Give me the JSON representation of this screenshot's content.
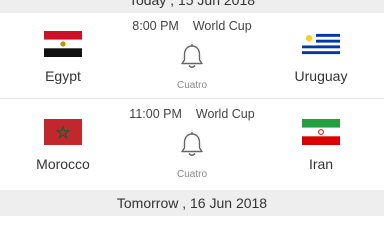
{
  "headers": {
    "current_date": "Today , 15 Jun 2018",
    "next_date": "Tomorrow , 16 Jun 2018"
  },
  "matches": [
    {
      "time": "8:00 PM",
      "competition": "World Cup",
      "home": {
        "name": "Egypt",
        "flag_icon": "egypt-flag-icon"
      },
      "away": {
        "name": "Uruguay",
        "flag_icon": "uruguay-flag-icon"
      },
      "channel": "Cuatro",
      "reminder_icon": "bell-icon"
    },
    {
      "time": "11:00 PM",
      "competition": "World Cup",
      "home": {
        "name": "Morocco",
        "flag_icon": "morocco-flag-icon"
      },
      "away": {
        "name": "Iran",
        "flag_icon": "iran-flag-icon"
      },
      "channel": "Cuatro",
      "reminder_icon": "bell-icon"
    }
  ],
  "colors": {
    "header_bg": "#eeeeee",
    "text": "#333333",
    "muted": "#888888"
  }
}
